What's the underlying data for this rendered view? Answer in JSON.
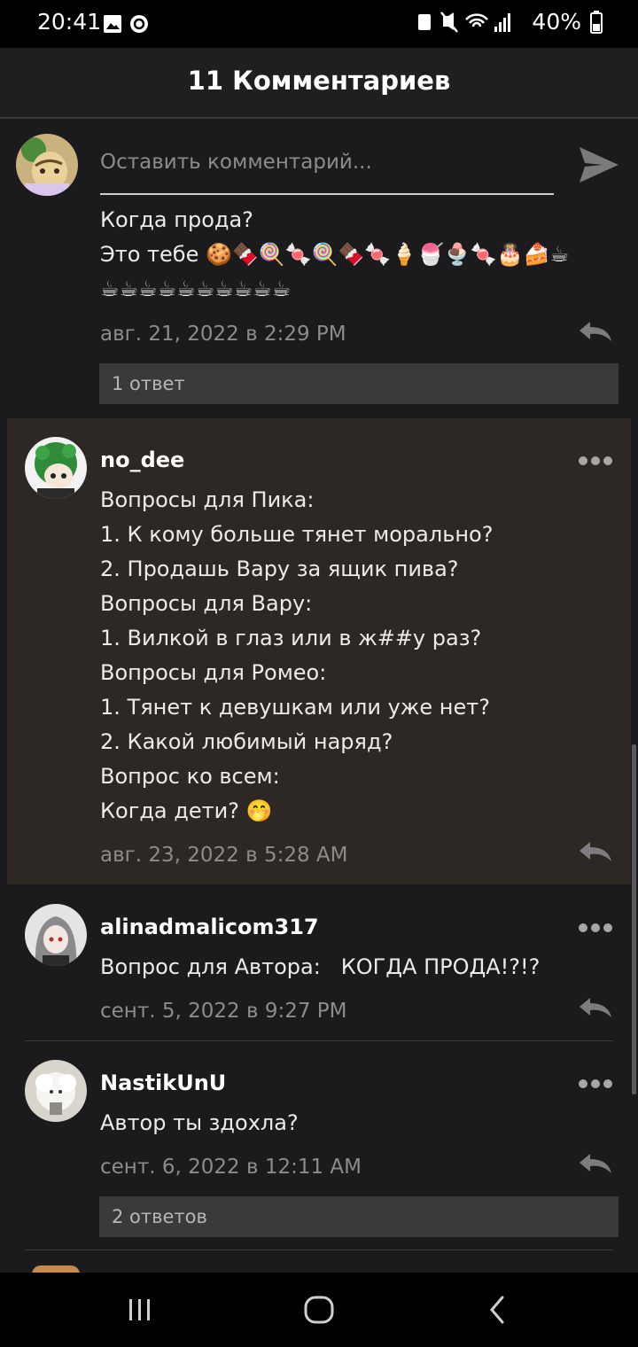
{
  "status_bar": {
    "time": "20:41",
    "battery": "40%"
  },
  "header": {
    "title": "11 Комментариев"
  },
  "compose": {
    "placeholder": "Оставить комментарий..."
  },
  "comments": [
    {
      "username": "",
      "lines": [
        "Когда прода?",
        "Это тебе 🍪🍫🍭🍬🍭🍫🍬🍦🍧🍨🍬🎂🍰☕",
        "☕☕☕☕☕☕☕☕☕☕"
      ],
      "date": "авг. 21, 2022 в 2:29 PM",
      "replies": "1 ответ"
    },
    {
      "username": "no_dee",
      "lines": [
        "Вопросы для Пика:",
        "1. К кому больше тянет морально?",
        "2. Продашь Вару за ящик пива?",
        "Вопросы для Вару:",
        "1. Вилкой в глаз или в ж##у раз?",
        "Вопросы для Ромео:",
        "1. Тянет к девушкам или уже нет?",
        "2. Какой любимый наряд?",
        "Вопрос ко всем:",
        "Когда дети? 🤭"
      ],
      "date": "авг. 23, 2022 в 5:28 AM"
    },
    {
      "username": "alinadmalicom317",
      "lines": [
        "Вопрос для Автора:   КОГДА ПРОДА!?!?"
      ],
      "date": "сент. 5, 2022 в 9:27 PM"
    },
    {
      "username": "NastikUnU",
      "lines": [
        "Автор ты здохла?"
      ],
      "date": "сент. 6, 2022 в 12:11 AM",
      "replies": "2 ответов"
    }
  ],
  "icons": {
    "send": "send-icon",
    "reply": "reply-icon",
    "more": "more-icon"
  }
}
